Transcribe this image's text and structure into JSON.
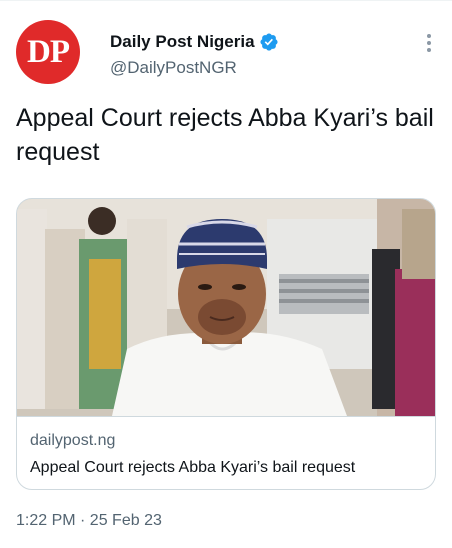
{
  "header": {
    "avatar_text": "DP",
    "display_name": "Daily Post Nigeria",
    "handle": "@DailyPostNGR",
    "verified_icon": "verified-badge-icon",
    "more_icon": "more-vertical-icon"
  },
  "tweet": {
    "text": "Appeal Court rejects Abba Kyari’s bail request"
  },
  "card": {
    "image_alt": "man-in-white-agbada-and-embroidered-cap",
    "domain": "dailypost.ng",
    "title": "Appeal Court rejects Abba Kyari’s bail request"
  },
  "meta": {
    "timestamp": "1:22 PM · 25 Feb 23"
  },
  "colors": {
    "avatar": "#e02a2a",
    "verified": "#1d9bf0",
    "secondary_text": "#536471",
    "border": "#cfd9de"
  }
}
